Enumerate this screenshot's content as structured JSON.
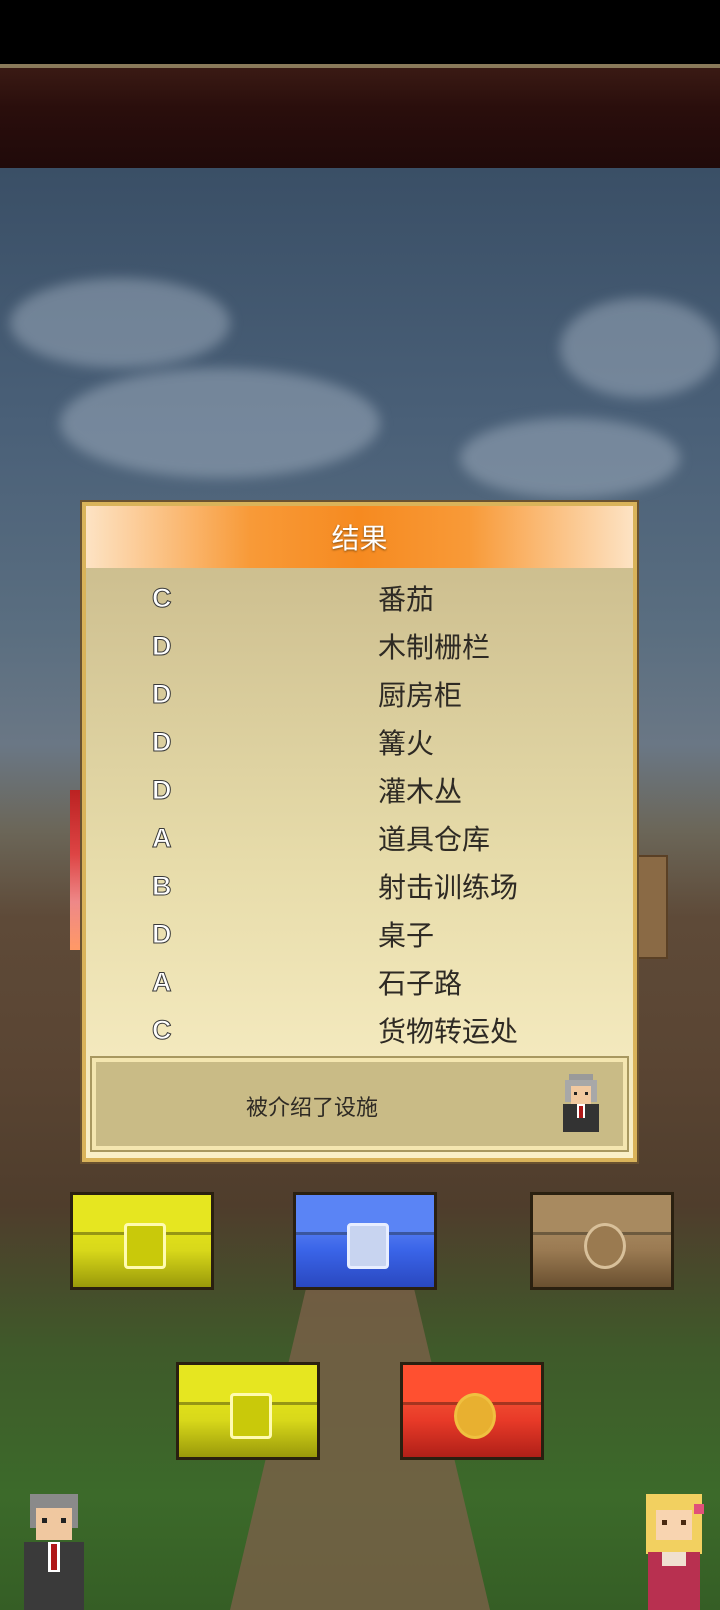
{
  "dialog": {
    "title": "结果",
    "results": [
      {
        "grade": "C",
        "facility": "番茄"
      },
      {
        "grade": "D",
        "facility": "木制栅栏"
      },
      {
        "grade": "D",
        "facility": "厨房柜"
      },
      {
        "grade": "D",
        "facility": "篝火"
      },
      {
        "grade": "D",
        "facility": "灌木丛"
      },
      {
        "grade": "A",
        "facility": "道具仓库"
      },
      {
        "grade": "B",
        "facility": "射击训练场"
      },
      {
        "grade": "D",
        "facility": "桌子"
      },
      {
        "grade": "A",
        "facility": "石子路"
      },
      {
        "grade": "C",
        "facility": "货物转运处"
      }
    ],
    "message": "被介绍了设施",
    "advisor_icon": "gray-haired-advisor-icon"
  },
  "chests": {
    "row1": [
      "gold-chest-icon",
      "blue-chest-icon",
      "wooden-chest-icon"
    ],
    "row2": [
      "gold-chest-icon",
      "red-chest-icon"
    ]
  },
  "characters": [
    "old-man-character-icon",
    "blonde-girl-character-icon"
  ],
  "colors": {
    "header_orange": "#f68a20",
    "dialog_bg": "#e7dcaa",
    "dialog_border": "#d9b35a",
    "text_dark": "#2e2a24"
  }
}
